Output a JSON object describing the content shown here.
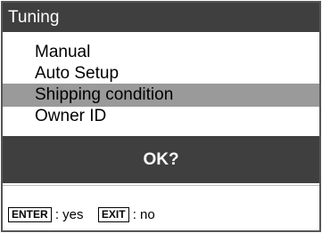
{
  "window": {
    "title": "Tuning"
  },
  "menu": {
    "items": [
      {
        "label": "Manual",
        "selected": false
      },
      {
        "label": "Auto Setup",
        "selected": false
      },
      {
        "label": "Shipping condition",
        "selected": true
      },
      {
        "label": "Owner ID",
        "selected": false
      }
    ]
  },
  "dialog": {
    "prompt": "OK?"
  },
  "footer": {
    "enter_key": "ENTER",
    "enter_text": " : yes",
    "exit_key": "EXIT",
    "exit_text": " : no"
  },
  "colors": {
    "title_bg": "#3f3f3f",
    "highlight": "#9a9a9a",
    "dialog_bg": "#3f3f3f"
  }
}
